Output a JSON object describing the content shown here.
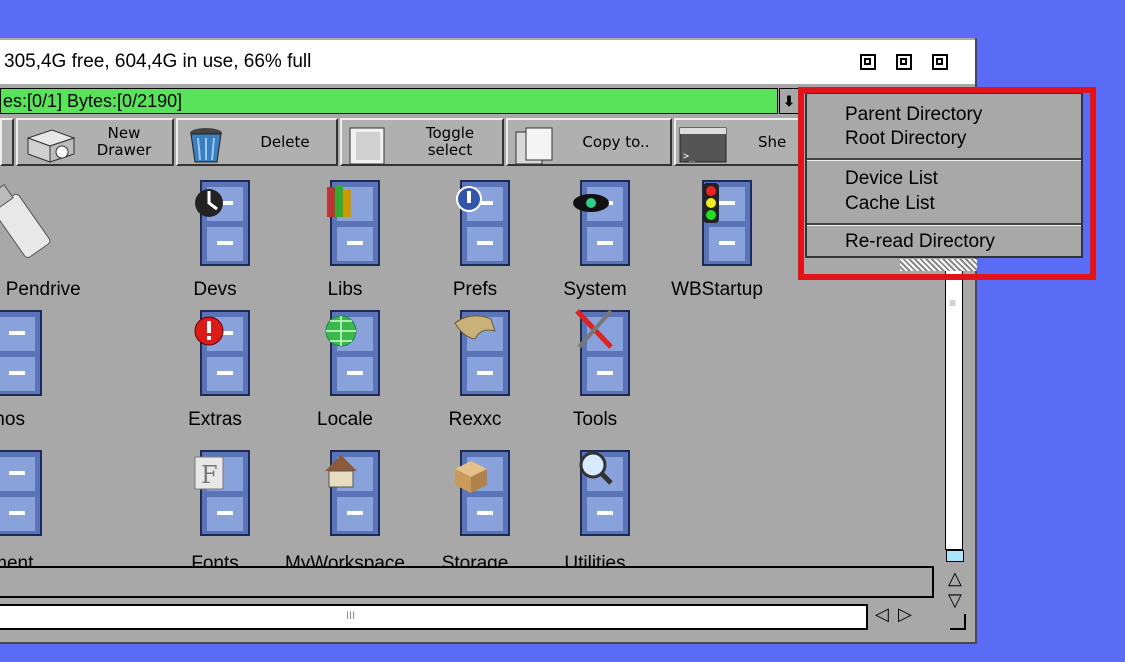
{
  "window": {
    "title": "305,4G free, 604,4G in use, 66% full",
    "status": "es:[0/1] Bytes:[0/2190]",
    "gadgets": [
      "zoom-icon",
      "depth-icon",
      "iconify-icon"
    ]
  },
  "toolbar": {
    "new_drawer": "New\nDrawer",
    "delete": "Delete",
    "toggle_select": "Toggle\nselect",
    "copy_to": "Copy to..",
    "shell": "She"
  },
  "icons": {
    "row1": [
      "ation Pendrive",
      "Devs",
      "Libs",
      "Prefs",
      "System",
      "WBStartup"
    ],
    "row2": [
      "mos",
      "Extras",
      "Locale",
      "Rexxc",
      "Tools"
    ],
    "row3": [
      "nment",
      "Fonts",
      "MyWorkspace",
      "Storage",
      "Utilities"
    ]
  },
  "menu": {
    "items": [
      "Parent Directory",
      "Root Directory",
      "Device List",
      "Cache List",
      "Re-read Directory"
    ]
  },
  "scroll": {
    "h_thumb_mark": "III",
    "v_thumb_mark": "≡"
  },
  "colors": {
    "desktop": "#5a6cf6",
    "status_bar": "#59e35a",
    "highlight": "#e3131a",
    "scroll_knob": "#a8e6ff"
  }
}
